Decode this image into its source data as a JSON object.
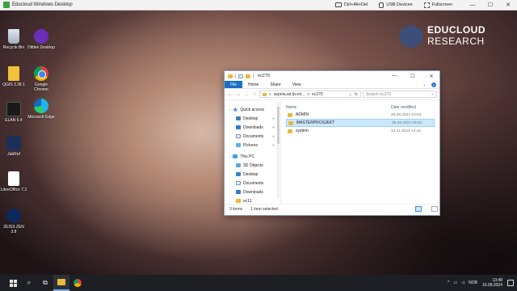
{
  "viewer": {
    "title": "Educloud Windows Desktop",
    "ctrl_alt_del": "Ctrl+Alt+Del",
    "usb": "USB Devices",
    "fullscreen": "Fullscreen",
    "minimize": "—",
    "maximize": "☐",
    "close": "✕"
  },
  "desktop_icons": {
    "left": [
      {
        "label": "Recycle Bin",
        "icon": "recycle-bin-icon"
      },
      {
        "label": "QGIS 3.38.1",
        "icon": "qgis-icon"
      },
      {
        "label": "ELAN 6.4",
        "icon": "elan-icon"
      },
      {
        "label": "JabRef",
        "icon": "jabref-icon"
      },
      {
        "label": "LibreOffice 7.2",
        "icon": "libreoffice-icon"
      },
      {
        "label": "ZEISS ZEN 3.8",
        "icon": "zeiss-icon"
      }
    ],
    "right": [
      {
        "label": "Dittlek Desktop",
        "icon": "dittlek-icon"
      },
      {
        "label": "Google Chrome",
        "icon": "chrome-icon"
      },
      {
        "label": "Microsoft Edge",
        "icon": "edge-icon"
      }
    ]
  },
  "brand": {
    "line1": "EDUCLOUD",
    "line2": "RESEARCH"
  },
  "explorer": {
    "title": "ec279",
    "minimize": "—",
    "maximize": "☐",
    "close": "✕",
    "ribbon": {
      "file": "File",
      "tabs": [
        "Home",
        "Share",
        "View"
      ]
    },
    "address": {
      "path_root": "aspeia.ad.fp.ed...",
      "sep": ">",
      "current": "ec279",
      "chevron": "⌄",
      "refresh": "↻"
    },
    "search_placeholder": "Search ec279",
    "nav": {
      "quick_access": "Quick access",
      "quick_items": [
        "Desktop",
        "Downloads",
        "Documents",
        "Pictures"
      ],
      "this_pc": "This PC",
      "pc_items": [
        "3D Objects",
        "Desktop",
        "Documents",
        "Downloads",
        "ec11"
      ]
    },
    "columns": {
      "name": "Name",
      "date": "Date modified"
    },
    "files": [
      {
        "name": "ADMIN",
        "date": "20.06.2024 10:53",
        "selected": false
      },
      {
        "name": "MASTERPROSJEKT",
        "date": "05.08.2024 09:53",
        "selected": true
      },
      {
        "name": "system",
        "date": "13.11.2023 14:16",
        "selected": false
      }
    ],
    "status": {
      "count": "3 items",
      "selected": "1 item selected"
    }
  },
  "taskbar": {
    "lang": "NOB",
    "time": "13:48",
    "date": "16.08.2024"
  }
}
